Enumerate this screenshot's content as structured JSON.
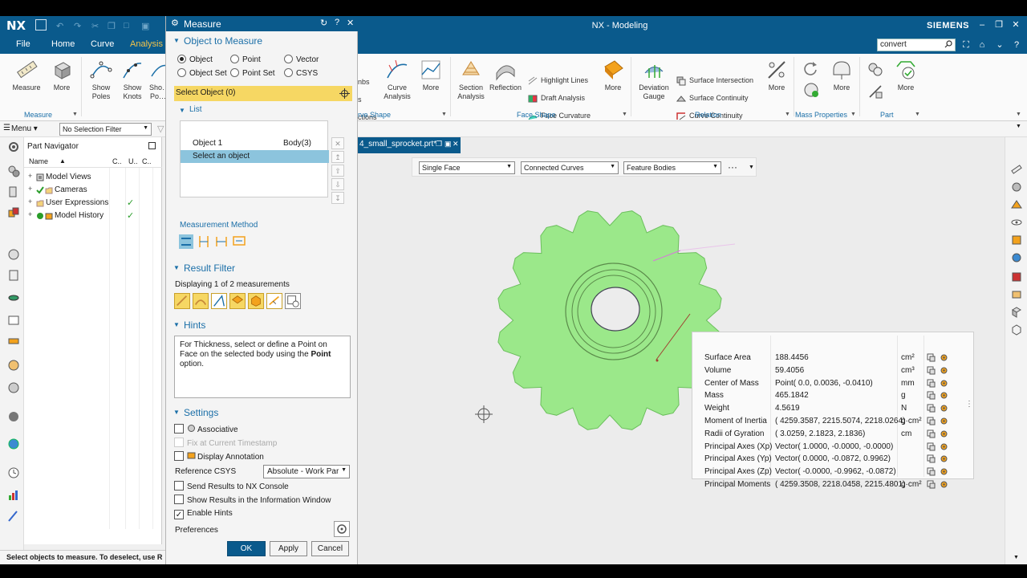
{
  "titlebar": {
    "logo": "NX",
    "title": "NX - Modeling",
    "brand": "SIEMENS"
  },
  "menu_tabs": [
    "File",
    "Home",
    "Curve",
    "Analysis"
  ],
  "search": {
    "value": "convert"
  },
  "ribbon": {
    "measure_group": {
      "label": "Measure",
      "buttons": [
        "Measure",
        "More"
      ]
    },
    "show_buttons": [
      "Show Poles",
      "Show Knots",
      "Sho… Po…"
    ],
    "curve_shape": {
      "label": "rve Shape",
      "buttons": [
        "Curve Analysis",
        "More"
      ],
      "cut_labels": [
        "nbs",
        "s",
        "ctions"
      ]
    },
    "face_shape": {
      "label": "Face Shape",
      "buttons": [
        "Section Analysis",
        "Reflection"
      ],
      "small": [
        "Highlight Lines",
        "Draft Analysis",
        "Face Curvature"
      ],
      "more": "More"
    },
    "relation": {
      "label": "Relation",
      "buttons": [
        "Deviation Gauge"
      ],
      "small": [
        "Surface Intersection",
        "Surface Continuity",
        "Curve Continuity"
      ],
      "more": "More"
    },
    "mass": {
      "label": "Mass Properties",
      "more": "More"
    },
    "part": {
      "label": "Part",
      "more": "More"
    }
  },
  "filter": {
    "menu": "Menu",
    "selection_filter": "No Selection Filter"
  },
  "part_navigator": {
    "title": "Part Navigator",
    "columns": [
      "Name",
      "C..",
      "U..",
      "C.."
    ],
    "rows": [
      {
        "label": "Model Views",
        "check": ""
      },
      {
        "label": "Cameras",
        "check": ""
      },
      {
        "label": "User Expressions",
        "check": "✓"
      },
      {
        "label": "Model History",
        "check": "✓"
      }
    ]
  },
  "status": "Select objects to measure. To deselect, use R",
  "dialog": {
    "title": "Measure",
    "sections": {
      "object": "Object to Measure",
      "result_filter": "Result Filter",
      "hints": "Hints",
      "settings": "Settings"
    },
    "radios": [
      "Object",
      "Point",
      "Vector",
      "Object Set",
      "Point Set",
      "CSYS"
    ],
    "select_object": "Select Object (0)",
    "list_label": "List",
    "list_rows": [
      {
        "c1": "Object 1",
        "c2": "Body(3)"
      },
      {
        "c1": "Select an object",
        "c2": ""
      }
    ],
    "measurement_method": "Measurement Method",
    "displaying": "Displaying 1 of 2 measurements",
    "hint_text": "For Thickness, select or define a Point on Face on the selected body using the ",
    "hint_bold": "Point",
    "hint_end": " option.",
    "settings": {
      "associative": "Associative",
      "fix_timestamp": "Fix at Current Timestamp",
      "display_annotation": "Display Annotation",
      "reference_csys_label": "Reference CSYS",
      "reference_csys_value": "Absolute - Work Par",
      "send_console": "Send Results to NX Console",
      "show_info": "Show Results in the Information Window",
      "enable_hints": "Enable Hints",
      "preferences": "Preferences"
    },
    "buttons": {
      "ok": "OK",
      "apply": "Apply",
      "cancel": "Cancel"
    }
  },
  "file_tab": "4_small_sprocket.prt*",
  "viewport_toolbar": {
    "face_rule": "Single Face",
    "curve_rule": "Connected Curves",
    "body_rule": "Feature Bodies",
    "more": "···"
  },
  "results": [
    {
      "name": "Surface Area",
      "value": "188.4456",
      "unit": "cm²"
    },
    {
      "name": "Volume",
      "value": "59.4056",
      "unit": "cm³"
    },
    {
      "name": "Center of Mass",
      "value": "Point( 0.0, 0.0036, -0.0410)",
      "unit": "mm"
    },
    {
      "name": "Mass",
      "value": "465.1842",
      "unit": "g"
    },
    {
      "name": "Weight",
      "value": "4.5619",
      "unit": "N"
    },
    {
      "name": "Moment of Inertia",
      "value": "( 4259.3587, 2215.5074, 2218.0264)",
      "unit": "g·cm²"
    },
    {
      "name": "Radii of Gyration",
      "value": "( 3.0259, 2.1823, 2.1836)",
      "unit": "cm"
    },
    {
      "name": "Principal Axes (Xp)",
      "value": "Vector( 1.0000, -0.0000, -0.0000)",
      "unit": ""
    },
    {
      "name": "Principal Axes (Yp)",
      "value": "Vector( 0.0000, -0.0872, 0.9962)",
      "unit": ""
    },
    {
      "name": "Principal Axes (Zp)",
      "value": "Vector( -0.0000, -0.9962, -0.0872)",
      "unit": ""
    },
    {
      "name": "Principal Moments",
      "value": "( 4259.3508, 2218.0458, 2215.4801)",
      "unit": "g·cm²"
    }
  ],
  "colors": {
    "nx_blue": "#0a5a8c",
    "select_yellow": "#f6d763",
    "part_green": "#9be88a",
    "accent_orange": "#f3a21d"
  }
}
